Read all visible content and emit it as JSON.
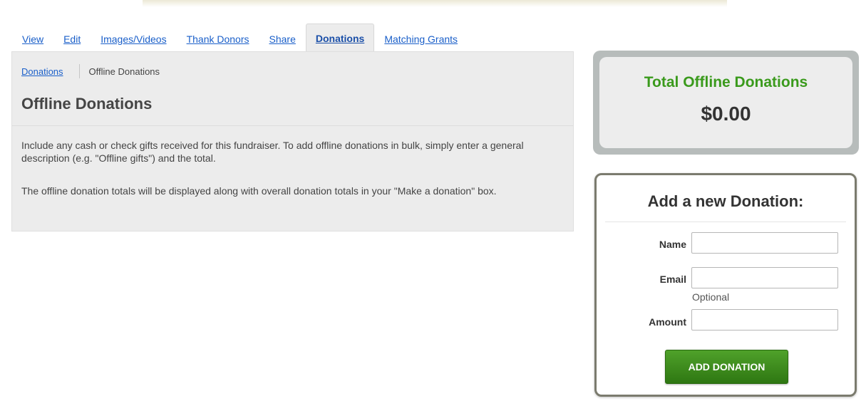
{
  "tabs": [
    {
      "label": "View"
    },
    {
      "label": "Edit"
    },
    {
      "label": "Images/Videos"
    },
    {
      "label": "Thank Donors"
    },
    {
      "label": "Share"
    },
    {
      "label": "Donations",
      "active": true
    },
    {
      "label": "Matching Grants"
    }
  ],
  "breadcrumb": {
    "link": "Donations",
    "current": "Offline Donations"
  },
  "main": {
    "title": "Offline Donations",
    "paragraphs": [
      "Include any cash or check gifts received for this fundraiser. To add offline donations in bulk, simply enter a general description (e.g. \"Offline gifts\") and the total.",
      "The offline donation totals will be displayed along with overall donation totals in your \"Make a donation\" box."
    ]
  },
  "totals": {
    "title": "Total Offline Donations",
    "amount": "$0.00"
  },
  "add_form": {
    "title": "Add a new Donation:",
    "name_label": "Name",
    "email_label": "Email",
    "email_hint": "Optional",
    "amount_label": "Amount",
    "name_value": "",
    "email_value": "",
    "amount_value": "",
    "submit_label": "ADD DONATION"
  },
  "colors": {
    "link": "#1a5fc9",
    "accent_green": "#3a9a1c",
    "button_green": "#3e8c1f"
  }
}
